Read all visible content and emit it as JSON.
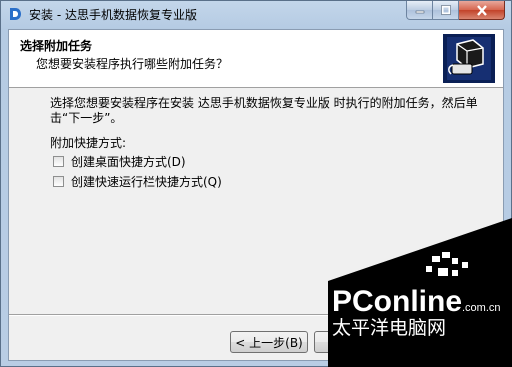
{
  "window": {
    "title": "安装 - 达思手机数据恢复专业版",
    "minimize_icon": "minimize-icon",
    "maximize_icon": "maximize-icon",
    "close_icon": "close-icon"
  },
  "header": {
    "title": "选择附加任务",
    "subtitle": "您想要安装程序执行哪些附加任务？"
  },
  "body": {
    "description": "选择您想要安装程序在安装 达思手机数据恢复专业版 时执行的附加任务，然后单击“下一步”。",
    "group_label": "附加快捷方式:",
    "options": [
      {
        "label": "创建桌面快捷方式(D)",
        "checked": false
      },
      {
        "label": "创建快速运行栏快捷方式(Q)",
        "checked": false
      }
    ]
  },
  "buttons": {
    "back": "< 上一步(B)",
    "next": "下"
  },
  "watermark": {
    "brand": "PConline",
    "domain": ".com.cn",
    "subtitle": "太平洋电脑网"
  },
  "colors": {
    "accent": "#1f5fa8",
    "close": "#c9462c"
  }
}
